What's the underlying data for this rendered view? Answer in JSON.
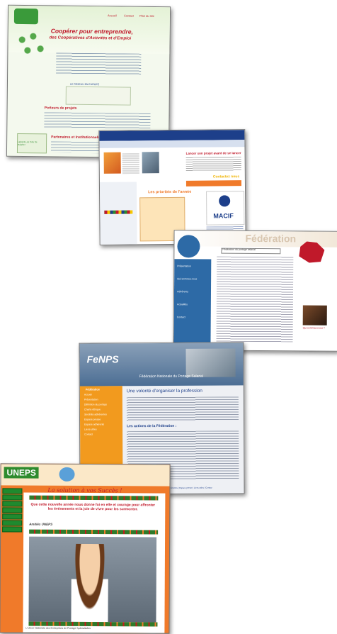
{
  "shot1": {
    "title_line1": "Coopérer pour entreprendre,",
    "title_line2": "des Coopératives d'Activités et d'Emploi",
    "nav": [
      "Accueil",
      "Contact",
      "Plan du site"
    ],
    "section_projets": "Porteurs de projets",
    "section_partenaires": "Partenaires et Institutionnels",
    "map_label": "LE RESEAU EN EUROPE",
    "logo_caption": "Laissez-Les CAE Se Répéter"
  },
  "shot2": {
    "tagline": "Lancer son projet avant de se lancer",
    "section_label": "Les priorités de l'année",
    "sponsor": "MACIF",
    "contact": "Contactez nous"
  },
  "shot3": {
    "brand": "Fédération",
    "select_value": "Fédération du portage salarial",
    "menu": [
      "Présentation",
      "Qui sommes-nous",
      "Adhérents",
      "Actualités",
      "Contact"
    ],
    "side_caption": "Qui sommes-nous ?"
  },
  "shot4": {
    "logo": "FeNPS",
    "subtitle": "Fédération Nationale du Portage Salarial",
    "heading": "Une volonté d'organiser la profession",
    "subheading": "Les actions de la Fédération :",
    "menu_title": "Fédération",
    "menu": [
      "Accueil",
      "Présentation",
      "Définition du portage",
      "Charte éthique",
      "Sociétés adhérentes",
      "Espace presse",
      "Espace adhérents",
      "Liens utiles",
      "Contact"
    ],
    "footer": "Accueil | Présentation | Charte éthique | Sociétés adhérentes | Espace presse | Liens utiles | Contact"
  },
  "shot5": {
    "logo": "UNEPS",
    "slogan": "La solution à vos Succès !",
    "message": "Que cette nouvelle année nous donne foi en elle et courage pour affronter les événements et la joie de vivre pour les surmonter.",
    "signature": "Amitiés UNEPS",
    "footer": "L'Union Nationale des Entreprises de Portage Spécialisées"
  },
  "colors": {
    "green": "#2e8b2e",
    "red": "#c0192a",
    "navy": "#1d3f8a",
    "orange": "#f07a2a",
    "teal": "#4c7ea6"
  }
}
